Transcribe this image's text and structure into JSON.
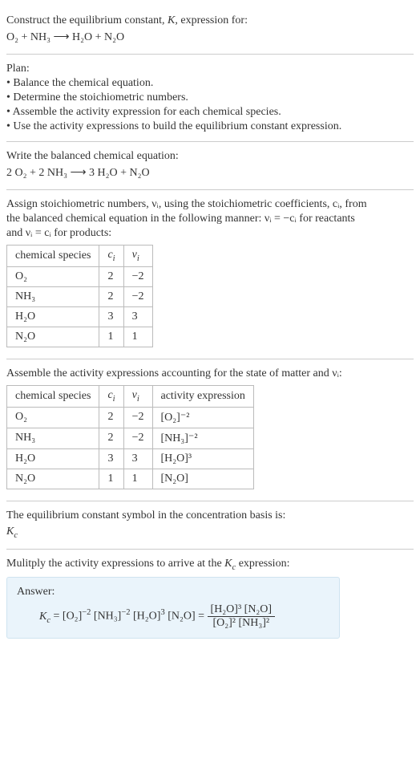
{
  "s1": {
    "l1": "Construct the equilibrium constant, K, expression for:",
    "eq": "O₂ + NH₃ ⟶ H₂O + N₂O"
  },
  "s2": {
    "title": "Plan:",
    "b1": "• Balance the chemical equation.",
    "b2": "• Determine the stoichiometric numbers.",
    "b3": "• Assemble the activity expression for each chemical species.",
    "b4": "• Use the activity expressions to build the equilibrium constant expression."
  },
  "s3": {
    "l1": "Write the balanced chemical equation:",
    "eq": "2 O₂ + 2 NH₃ ⟶ 3 H₂O + N₂O"
  },
  "s4": {
    "intro1": "Assign stoichiometric numbers, νᵢ, using the stoichiometric coefficients, cᵢ, from",
    "intro2": "the balanced chemical equation in the following manner: νᵢ = −cᵢ for reactants",
    "intro3": "and νᵢ = cᵢ for products:",
    "h1": "chemical species",
    "h2": "cᵢ",
    "h3": "νᵢ",
    "r1c1": "O₂",
    "r1c2": "2",
    "r1c3": "−2",
    "r2c1": "NH₃",
    "r2c2": "2",
    "r2c3": "−2",
    "r3c1": "H₂O",
    "r3c2": "3",
    "r3c3": "3",
    "r4c1": "N₂O",
    "r4c2": "1",
    "r4c3": "1"
  },
  "s5": {
    "intro": "Assemble the activity expressions accounting for the state of matter and νᵢ:",
    "h1": "chemical species",
    "h2": "cᵢ",
    "h3": "νᵢ",
    "h4": "activity expression",
    "r1c1": "O₂",
    "r1c2": "2",
    "r1c3": "−2",
    "r1c4": "[O₂]⁻²",
    "r2c1": "NH₃",
    "r2c2": "2",
    "r2c3": "−2",
    "r2c4": "[NH₃]⁻²",
    "r3c1": "H₂O",
    "r3c2": "3",
    "r3c3": "3",
    "r3c4": "[H₂O]³",
    "r4c1": "N₂O",
    "r4c2": "1",
    "r4c3": "1",
    "r4c4": "[N₂O]"
  },
  "s6": {
    "l1": "The equilibrium constant symbol in the concentration basis is:",
    "sym": "K꜀"
  },
  "s7": {
    "l1": "Mulitply the activity expressions to arrive at the K꜀ expression:",
    "answer_label": "Answer:",
    "lhs": "K꜀ = [O₂]⁻² [NH₃]⁻² [H₂O]³ [N₂O] = ",
    "num": "[H₂O]³ [N₂O]",
    "den": "[O₂]² [NH₃]²"
  }
}
